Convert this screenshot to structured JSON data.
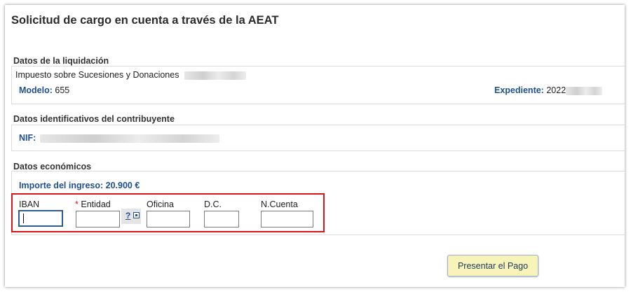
{
  "page": {
    "title": "Solicitud de cargo en cuenta a través de la AEAT"
  },
  "liquidacion": {
    "section_title": "Datos de la liquidación",
    "impuesto": "Impuesto sobre Sucesiones y Donaciones",
    "modelo_label": "Modelo:",
    "modelo_value": "655",
    "expediente_label": "Expediente:",
    "expediente_value": "2022"
  },
  "contribuyente": {
    "section_title": "Datos identificativos del contribuyente",
    "nif_label": "NIF:"
  },
  "economicos": {
    "section_title": "Datos económicos",
    "importe_label": "Importe del ingreso:",
    "importe_value": "20.900 €"
  },
  "cuenta": {
    "iban_label": "IBAN",
    "entidad_required_mark": "*",
    "entidad_label": "Entidad",
    "help_label": "?",
    "oficina_label": "Oficina",
    "dc_label": "D.C.",
    "ncuenta_label": "N.Cuenta",
    "iban_value": "",
    "entidad_value": "",
    "oficina_value": "",
    "dc_value": "",
    "ncuenta_value": ""
  },
  "actions": {
    "submit_label": "Presentar el Pago"
  },
  "colors": {
    "label_blue": "#1f4f8f",
    "highlight_red": "#d9161b",
    "button_bg": "#f7f3b9"
  }
}
